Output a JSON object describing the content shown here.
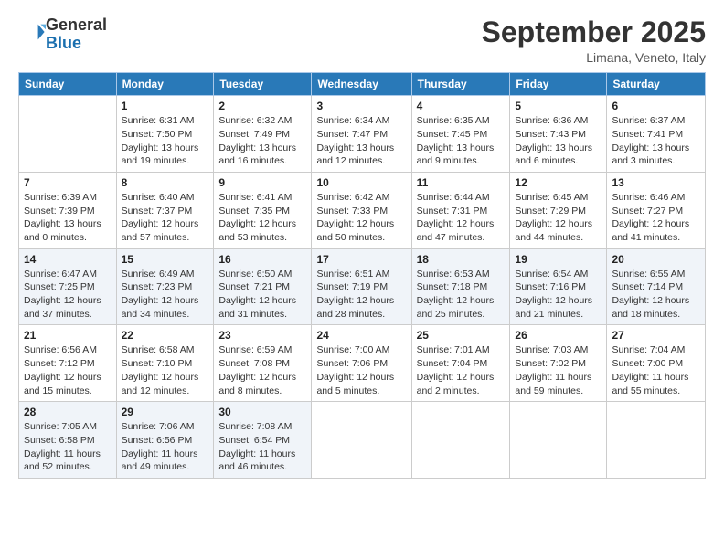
{
  "header": {
    "logo_line1": "General",
    "logo_line2": "Blue",
    "month": "September 2025",
    "location": "Limana, Veneto, Italy"
  },
  "weekdays": [
    "Sunday",
    "Monday",
    "Tuesday",
    "Wednesday",
    "Thursday",
    "Friday",
    "Saturday"
  ],
  "weeks": [
    [
      {
        "day": "",
        "info": ""
      },
      {
        "day": "1",
        "info": "Sunrise: 6:31 AM\nSunset: 7:50 PM\nDaylight: 13 hours\nand 19 minutes."
      },
      {
        "day": "2",
        "info": "Sunrise: 6:32 AM\nSunset: 7:49 PM\nDaylight: 13 hours\nand 16 minutes."
      },
      {
        "day": "3",
        "info": "Sunrise: 6:34 AM\nSunset: 7:47 PM\nDaylight: 13 hours\nand 12 minutes."
      },
      {
        "day": "4",
        "info": "Sunrise: 6:35 AM\nSunset: 7:45 PM\nDaylight: 13 hours\nand 9 minutes."
      },
      {
        "day": "5",
        "info": "Sunrise: 6:36 AM\nSunset: 7:43 PM\nDaylight: 13 hours\nand 6 minutes."
      },
      {
        "day": "6",
        "info": "Sunrise: 6:37 AM\nSunset: 7:41 PM\nDaylight: 13 hours\nand 3 minutes."
      }
    ],
    [
      {
        "day": "7",
        "info": "Sunrise: 6:39 AM\nSunset: 7:39 PM\nDaylight: 13 hours\nand 0 minutes."
      },
      {
        "day": "8",
        "info": "Sunrise: 6:40 AM\nSunset: 7:37 PM\nDaylight: 12 hours\nand 57 minutes."
      },
      {
        "day": "9",
        "info": "Sunrise: 6:41 AM\nSunset: 7:35 PM\nDaylight: 12 hours\nand 53 minutes."
      },
      {
        "day": "10",
        "info": "Sunrise: 6:42 AM\nSunset: 7:33 PM\nDaylight: 12 hours\nand 50 minutes."
      },
      {
        "day": "11",
        "info": "Sunrise: 6:44 AM\nSunset: 7:31 PM\nDaylight: 12 hours\nand 47 minutes."
      },
      {
        "day": "12",
        "info": "Sunrise: 6:45 AM\nSunset: 7:29 PM\nDaylight: 12 hours\nand 44 minutes."
      },
      {
        "day": "13",
        "info": "Sunrise: 6:46 AM\nSunset: 7:27 PM\nDaylight: 12 hours\nand 41 minutes."
      }
    ],
    [
      {
        "day": "14",
        "info": "Sunrise: 6:47 AM\nSunset: 7:25 PM\nDaylight: 12 hours\nand 37 minutes."
      },
      {
        "day": "15",
        "info": "Sunrise: 6:49 AM\nSunset: 7:23 PM\nDaylight: 12 hours\nand 34 minutes."
      },
      {
        "day": "16",
        "info": "Sunrise: 6:50 AM\nSunset: 7:21 PM\nDaylight: 12 hours\nand 31 minutes."
      },
      {
        "day": "17",
        "info": "Sunrise: 6:51 AM\nSunset: 7:19 PM\nDaylight: 12 hours\nand 28 minutes."
      },
      {
        "day": "18",
        "info": "Sunrise: 6:53 AM\nSunset: 7:18 PM\nDaylight: 12 hours\nand 25 minutes."
      },
      {
        "day": "19",
        "info": "Sunrise: 6:54 AM\nSunset: 7:16 PM\nDaylight: 12 hours\nand 21 minutes."
      },
      {
        "day": "20",
        "info": "Sunrise: 6:55 AM\nSunset: 7:14 PM\nDaylight: 12 hours\nand 18 minutes."
      }
    ],
    [
      {
        "day": "21",
        "info": "Sunrise: 6:56 AM\nSunset: 7:12 PM\nDaylight: 12 hours\nand 15 minutes."
      },
      {
        "day": "22",
        "info": "Sunrise: 6:58 AM\nSunset: 7:10 PM\nDaylight: 12 hours\nand 12 minutes."
      },
      {
        "day": "23",
        "info": "Sunrise: 6:59 AM\nSunset: 7:08 PM\nDaylight: 12 hours\nand 8 minutes."
      },
      {
        "day": "24",
        "info": "Sunrise: 7:00 AM\nSunset: 7:06 PM\nDaylight: 12 hours\nand 5 minutes."
      },
      {
        "day": "25",
        "info": "Sunrise: 7:01 AM\nSunset: 7:04 PM\nDaylight: 12 hours\nand 2 minutes."
      },
      {
        "day": "26",
        "info": "Sunrise: 7:03 AM\nSunset: 7:02 PM\nDaylight: 11 hours\nand 59 minutes."
      },
      {
        "day": "27",
        "info": "Sunrise: 7:04 AM\nSunset: 7:00 PM\nDaylight: 11 hours\nand 55 minutes."
      }
    ],
    [
      {
        "day": "28",
        "info": "Sunrise: 7:05 AM\nSunset: 6:58 PM\nDaylight: 11 hours\nand 52 minutes."
      },
      {
        "day": "29",
        "info": "Sunrise: 7:06 AM\nSunset: 6:56 PM\nDaylight: 11 hours\nand 49 minutes."
      },
      {
        "day": "30",
        "info": "Sunrise: 7:08 AM\nSunset: 6:54 PM\nDaylight: 11 hours\nand 46 minutes."
      },
      {
        "day": "",
        "info": ""
      },
      {
        "day": "",
        "info": ""
      },
      {
        "day": "",
        "info": ""
      },
      {
        "day": "",
        "info": ""
      }
    ]
  ]
}
